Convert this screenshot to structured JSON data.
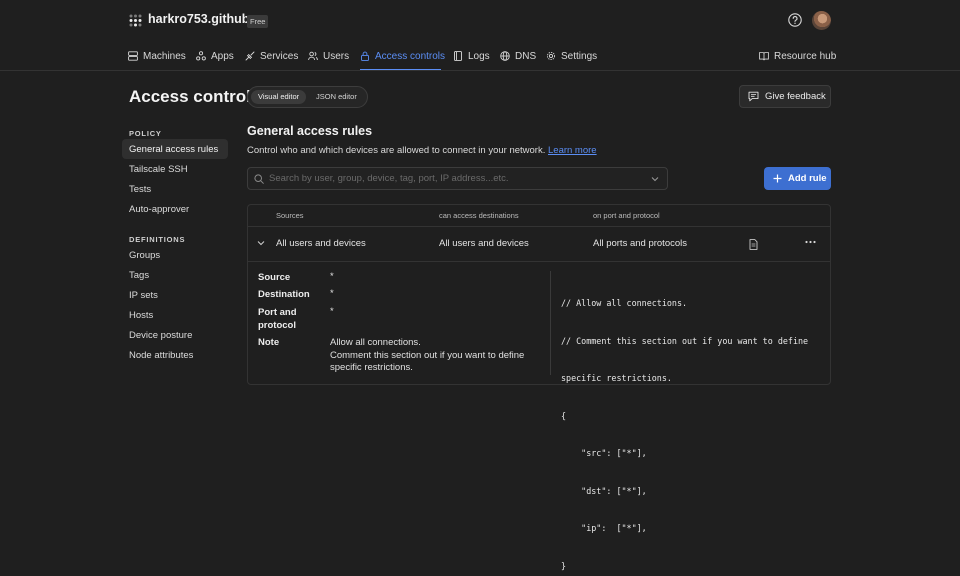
{
  "org": {
    "name": "harkro753.github",
    "plan": "Free"
  },
  "nav": {
    "items": [
      {
        "label": "Machines",
        "icon": "server-icon"
      },
      {
        "label": "Apps",
        "icon": "apps-icon"
      },
      {
        "label": "Services",
        "icon": "services-icon"
      },
      {
        "label": "Users",
        "icon": "users-icon"
      },
      {
        "label": "Access controls",
        "icon": "lock-icon",
        "active": true
      },
      {
        "label": "Logs",
        "icon": "logs-icon"
      },
      {
        "label": "DNS",
        "icon": "globe-icon"
      },
      {
        "label": "Settings",
        "icon": "gear-icon"
      }
    ],
    "resource_hub": "Resource hub",
    "accent": "#5b8ef5"
  },
  "header": {
    "title": "Access controls",
    "editor_tabs": [
      "Visual editor",
      "JSON editor"
    ],
    "feedback": "Give feedback"
  },
  "sidebar": {
    "policy_heading": "POLICY",
    "policy_items": [
      "General access rules",
      "Tailscale SSH",
      "Tests",
      "Auto-approver"
    ],
    "definitions_heading": "DEFINITIONS",
    "definition_items": [
      "Groups",
      "Tags",
      "IP sets",
      "Hosts",
      "Device posture",
      "Node attributes"
    ]
  },
  "main": {
    "title": "General access rules",
    "description": "Control who and which devices are allowed to connect in your network.",
    "learn_more": "Learn more",
    "search_placeholder": "Search by user, group, device, tag, port, IP address...etc.",
    "add_rule": "Add rule",
    "columns": [
      "Sources",
      "can access destinations",
      "on port and protocol"
    ],
    "rule": {
      "source": "All users and devices",
      "destination": "All users and devices",
      "ports": "All ports and protocols"
    },
    "details": {
      "source_label": "Source",
      "source_value": "*",
      "destination_label": "Destination",
      "destination_value": "*",
      "port_label_1": "Port and",
      "port_label_2": "protocol",
      "port_value": "*",
      "note_label": "Note",
      "note_lines": [
        "Allow all connections.",
        "Comment this section out if you want to define",
        "specific restrictions."
      ]
    },
    "code_lines": [
      "// Allow all connections.",
      "// Comment this section out if you want to define",
      "specific restrictions.",
      "{",
      "    \"src\": [\"*\"],",
      "    \"dst\": [\"*\"],",
      "    \"ip\":  [\"*\"],",
      "}"
    ]
  }
}
